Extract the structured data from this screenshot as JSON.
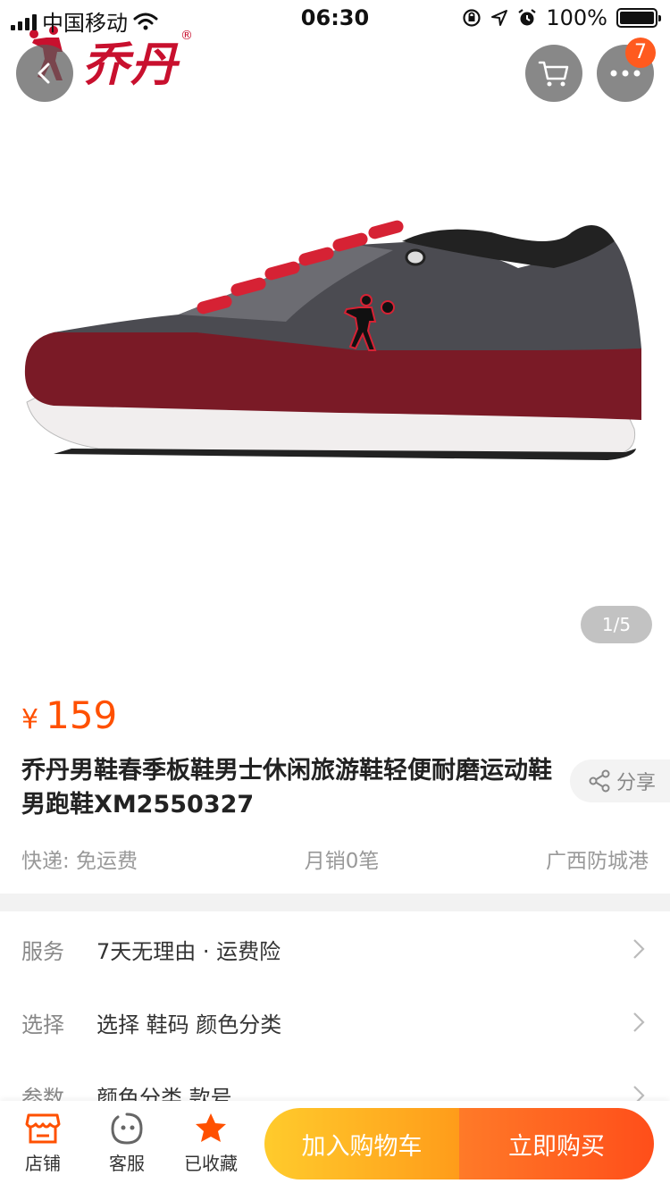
{
  "status_bar": {
    "carrier": "中国移动",
    "time": "06:30",
    "battery": "100%"
  },
  "gallery": {
    "brand": "乔丹",
    "brand_mark": "®",
    "cart_badge": "7",
    "page_indicator": "1/5"
  },
  "product": {
    "currency": "¥",
    "price": "159",
    "title": "乔丹男鞋春季板鞋男士休闲旅游鞋轻便耐磨运动鞋男跑鞋XM2550327",
    "share_label": "分享",
    "shipping": "快递: 免运费",
    "monthly_sales": "月销0笔",
    "location": "广西防城港"
  },
  "specs": [
    {
      "label": "服务",
      "value": "7天无理由 · 运费险"
    },
    {
      "label": "选择",
      "value": "选择 鞋码 颜色分类"
    },
    {
      "label": "参数",
      "value": "颜色分类 款号"
    }
  ],
  "bottom_bar": {
    "shop": "店铺",
    "service": "客服",
    "favorited": "已收藏",
    "add_to_cart": "加入购物车",
    "buy_now": "立即购买"
  },
  "colors": {
    "accent": "#ff5000",
    "cart_gradient_start": "#ffcb2c",
    "buy_gradient_end": "#ff4e1a",
    "brand_red": "#c8102e"
  }
}
